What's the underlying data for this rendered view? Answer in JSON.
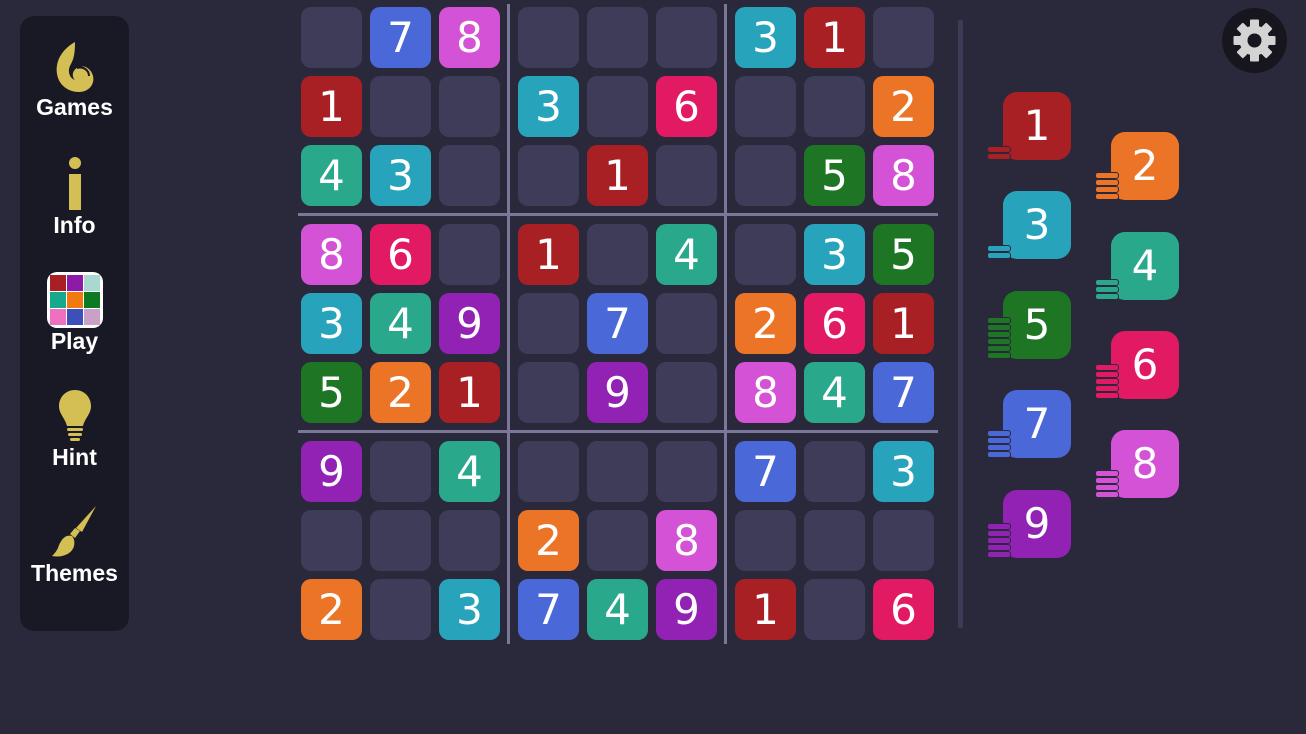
{
  "sidebar": {
    "items": [
      {
        "id": "games",
        "label": "Games",
        "icon": "music-note-icon"
      },
      {
        "id": "info",
        "label": "Info",
        "icon": "info-icon"
      },
      {
        "id": "play",
        "label": "Play",
        "icon": "color-grid-icon"
      },
      {
        "id": "hint",
        "label": "Hint",
        "icon": "lightbulb-icon"
      },
      {
        "id": "themes",
        "label": "Themes",
        "icon": "paintbrush-icon"
      }
    ],
    "accent_color": "#d4bf55"
  },
  "settings": {
    "icon": "gear-icon"
  },
  "colors": {
    "1": "#a82024",
    "2": "#ec7427",
    "3": "#27a4bc",
    "4": "#2aa88c",
    "5": "#1e7625",
    "6": "#e21a63",
    "7": "#4b68d8",
    "8": "#d352d5",
    "9": "#9222b3",
    "empty": "#3f3c5a"
  },
  "board": [
    [
      0,
      7,
      8,
      0,
      0,
      0,
      3,
      1,
      0
    ],
    [
      1,
      0,
      0,
      3,
      0,
      6,
      0,
      0,
      2
    ],
    [
      4,
      3,
      0,
      0,
      1,
      0,
      0,
      5,
      8
    ],
    [
      8,
      6,
      0,
      1,
      0,
      4,
      0,
      3,
      5
    ],
    [
      3,
      4,
      9,
      0,
      7,
      0,
      2,
      6,
      1
    ],
    [
      5,
      2,
      1,
      0,
      9,
      0,
      8,
      4,
      7
    ],
    [
      9,
      0,
      4,
      0,
      0,
      0,
      7,
      0,
      3
    ],
    [
      0,
      0,
      0,
      2,
      0,
      8,
      0,
      0,
      0
    ],
    [
      2,
      0,
      3,
      7,
      4,
      9,
      1,
      0,
      6
    ]
  ],
  "palette": [
    {
      "digit": "1",
      "remaining": 2
    },
    {
      "digit": "2",
      "remaining": 4
    },
    {
      "digit": "3",
      "remaining": 2
    },
    {
      "digit": "4",
      "remaining": 3
    },
    {
      "digit": "5",
      "remaining": 6
    },
    {
      "digit": "6",
      "remaining": 5
    },
    {
      "digit": "7",
      "remaining": 4
    },
    {
      "digit": "8",
      "remaining": 4
    },
    {
      "digit": "9",
      "remaining": 5
    }
  ]
}
